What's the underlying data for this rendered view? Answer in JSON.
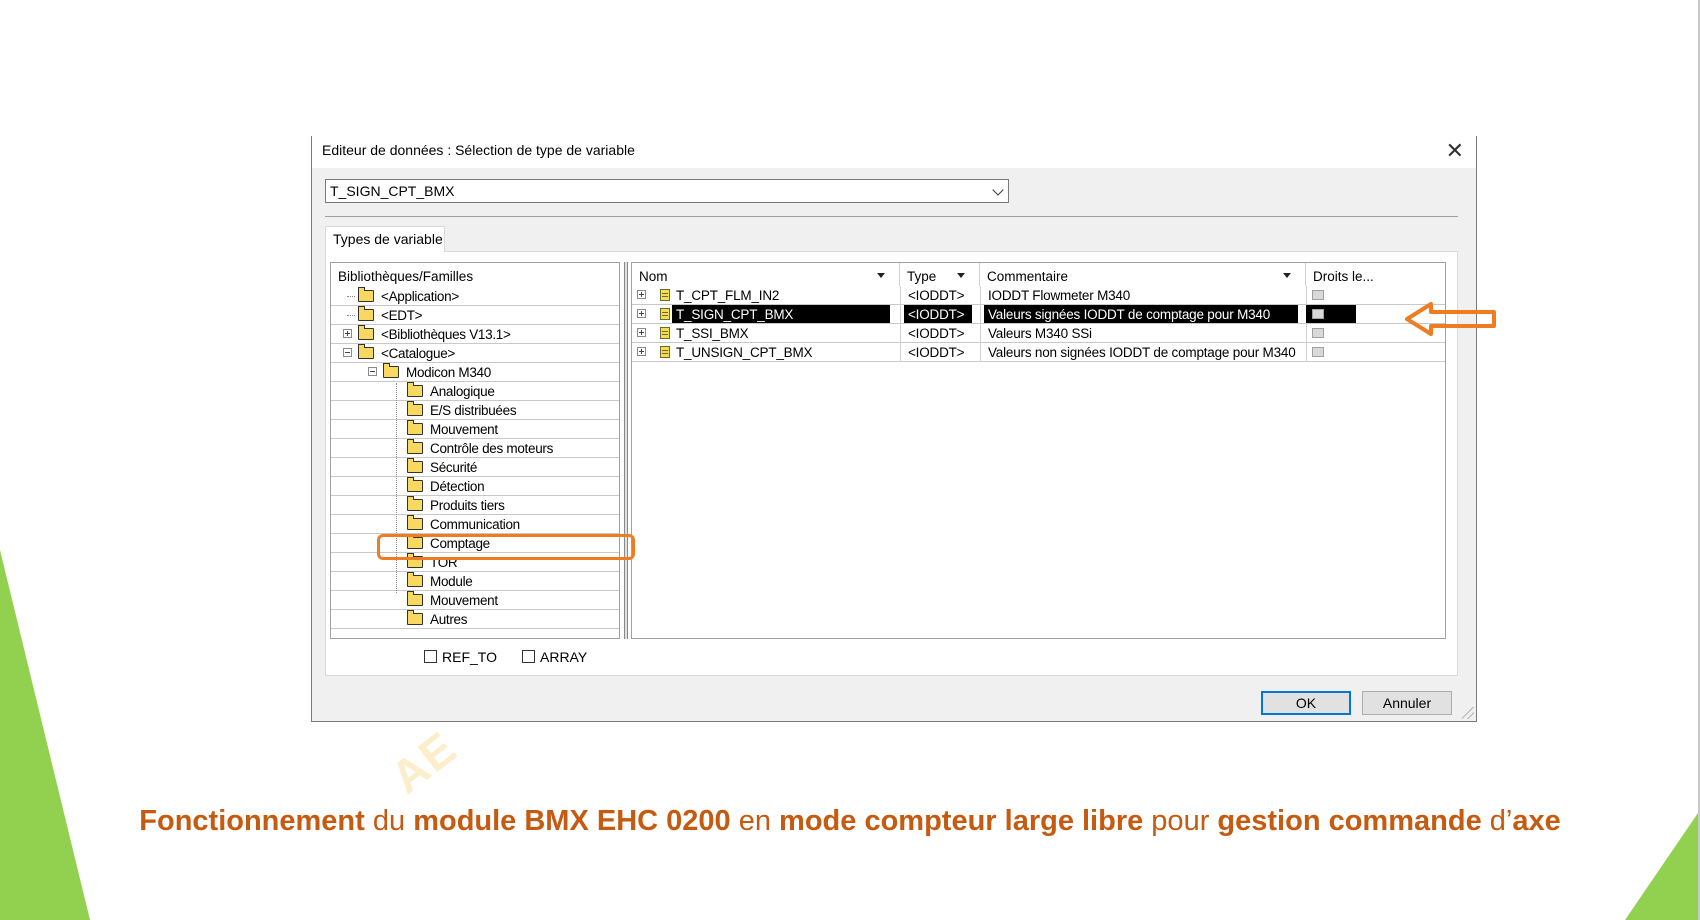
{
  "theme": {
    "accent_orange": "#f07c22",
    "caption_color": "#c55a11",
    "green": "#92d050",
    "selection_bg": "#000000",
    "ok_border": "#0078d7"
  },
  "dialog": {
    "title": "Editeur de données : Sélection de type de variable",
    "close_icon": "close-icon",
    "combo_value": "T_SIGN_CPT_BMX",
    "tab_label": "Types de variable",
    "tree": {
      "header": "Bibliothèques/Familles",
      "items": [
        {
          "label": "<Application>",
          "level": 0,
          "expander": "none",
          "icon": "folder-icon"
        },
        {
          "label": "<EDT>",
          "level": 0,
          "expander": "none",
          "icon": "folder-icon"
        },
        {
          "label": "<Bibliothèques V13.1>",
          "level": 0,
          "expander": "plus",
          "icon": "folder-icon"
        },
        {
          "label": "<Catalogue>",
          "level": 0,
          "expander": "minus",
          "icon": "open-folder-icon"
        },
        {
          "label": "Modicon M340",
          "level": 1,
          "expander": "minus",
          "icon": "open-folder-icon"
        },
        {
          "label": "Analogique",
          "level": 2,
          "expander": "none",
          "icon": "folder-icon"
        },
        {
          "label": "E/S distribuées",
          "level": 2,
          "expander": "none",
          "icon": "folder-icon"
        },
        {
          "label": "Mouvement",
          "level": 2,
          "expander": "none",
          "icon": "folder-icon"
        },
        {
          "label": "Contrôle des moteurs",
          "level": 2,
          "expander": "none",
          "icon": "folder-icon"
        },
        {
          "label": "Sécurité",
          "level": 2,
          "expander": "none",
          "icon": "folder-icon"
        },
        {
          "label": "Détection",
          "level": 2,
          "expander": "none",
          "icon": "folder-icon"
        },
        {
          "label": "Produits tiers",
          "level": 2,
          "expander": "none",
          "icon": "folder-icon"
        },
        {
          "label": "Communication",
          "level": 2,
          "expander": "none",
          "icon": "folder-icon"
        },
        {
          "label": "Comptage",
          "level": 2,
          "expander": "none",
          "icon": "folder-icon"
        },
        {
          "label": "TOR",
          "level": 2,
          "expander": "none",
          "icon": "folder-icon"
        },
        {
          "label": "Module",
          "level": 2,
          "expander": "none",
          "icon": "folder-icon"
        },
        {
          "label": "Mouvement",
          "level": 2,
          "expander": "none",
          "icon": "folder-icon"
        },
        {
          "label": "Autres",
          "level": 2,
          "expander": "none",
          "icon": "folder-icon"
        }
      ]
    },
    "grid": {
      "columns": [
        "Nom",
        "Type",
        "Commentaire",
        "Droits le..."
      ],
      "rows": [
        {
          "name": "T_CPT_FLM_IN2",
          "type": "<IODDT>",
          "comment": "IODDT Flowmeter  M340",
          "selected": false
        },
        {
          "name": "T_SIGN_CPT_BMX",
          "type": "<IODDT>",
          "comment": "Valeurs signées IODDT de comptage pour M340",
          "selected": true
        },
        {
          "name": "T_SSI_BMX",
          "type": "<IODDT>",
          "comment": "Valeurs M340 SSi",
          "selected": false
        },
        {
          "name": "T_UNSIGN_CPT_BMX",
          "type": "<IODDT>",
          "comment": "Valeurs non signées IODDT de comptage pour M340",
          "selected": false
        }
      ]
    },
    "checkboxes": [
      {
        "label": "REF_TO",
        "checked": false
      },
      {
        "label": "ARRAY",
        "checked": false
      }
    ],
    "buttons": {
      "ok": "OK",
      "cancel": "Annuler"
    }
  },
  "watermark": "AE",
  "caption": [
    {
      "text": "Fonctionnement",
      "bold": true
    },
    {
      "text": " du ",
      "bold": false
    },
    {
      "text": "module BMX EHC 0200",
      "bold": true
    },
    {
      "text": " en ",
      "bold": false
    },
    {
      "text": "mode compteur large libre",
      "bold": true
    },
    {
      "text": " pour ",
      "bold": false
    },
    {
      "text": "gestion commande",
      "bold": true
    },
    {
      "text": " d’",
      "bold": false
    },
    {
      "text": "axe",
      "bold": true
    }
  ]
}
